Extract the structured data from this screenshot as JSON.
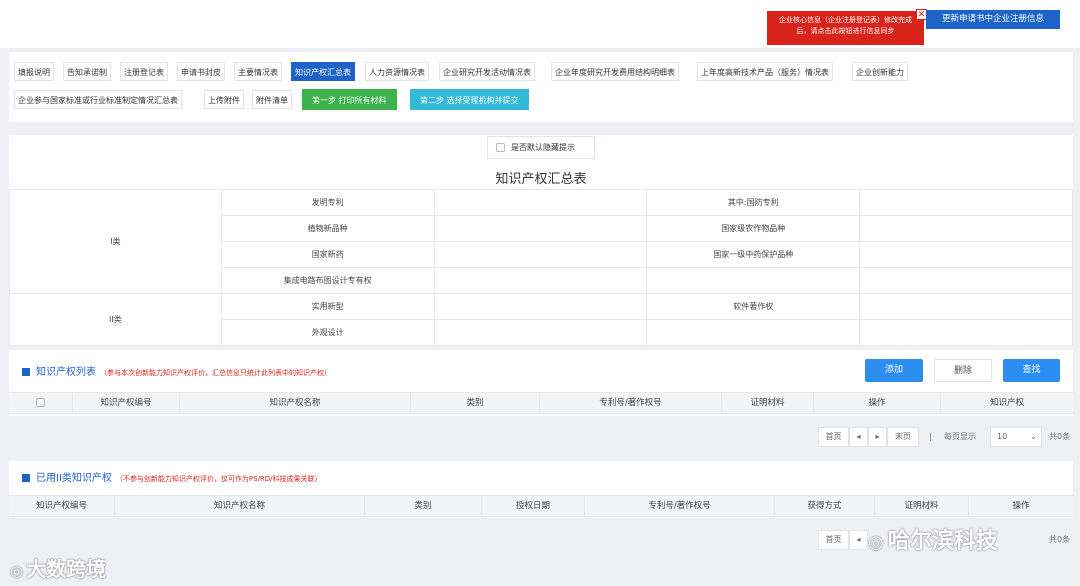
{
  "alert": {
    "text": "企业核心信息（企业注册登记表）修改完成后，请点击此按钮进行信息同步",
    "close_glyph": "✕"
  },
  "update_button": "更新申请书中企业注册信息",
  "tabs": [
    "填报说明",
    "告知承诺制",
    "注册登记表",
    "申请书封皮",
    "主要情况表",
    "知识产权汇总表",
    "人力资源情况表",
    "企业研究开发活动情况表",
    "企业年度研究开发费用结构明细表",
    "上年度高新技术产品（服务）情况表",
    "企业创新能力",
    "企业参与国家标准或行业标准制定情况汇总表",
    "上传附件",
    "附件清单"
  ],
  "step_buttons": {
    "step1": "第一步 打印所有材料",
    "step2": "第二步 选择受理机构并提交"
  },
  "hide_tip_label": "是否默认隐藏提示",
  "summary": {
    "title": "知识产权汇总表",
    "class1": "I类",
    "class2": "II类",
    "rows": [
      [
        "发明专利",
        "其中:国防专利"
      ],
      [
        "植物新品种",
        "国家级农作物品种"
      ],
      [
        "国家新药",
        "国家一级中药保护品种"
      ],
      [
        "集成电路布图设计专有权",
        ""
      ],
      [
        "实用新型",
        "软件著作权"
      ],
      [
        "外观设计",
        ""
      ]
    ]
  },
  "ip_list": {
    "title": "知识产权列表",
    "note": "（参与本次创新能力知识产权评价，汇总信息只统计此列表中的知识产权）",
    "add": "添加",
    "delete": "删除",
    "search": "查找",
    "columns": [
      "知识产权编号",
      "知识产权名称",
      "类别",
      "专利号/著作权号",
      "证明材料",
      "操作",
      "知识产权"
    ]
  },
  "pager": {
    "first": "首页",
    "prev": "◂",
    "next": "▸",
    "last": "末页",
    "sep": "|",
    "per_page_label": "每页显示",
    "per_page": "10",
    "total": "共0条",
    "dropdown": "⌄"
  },
  "class2_list": {
    "title": "已用II类知识产权",
    "note": "（不参与创新能力知识产权评价，仅可作为PS/RD/科技成果关联）",
    "columns": [
      "知识产权编号",
      "知识产权名称",
      "类别",
      "授权日期",
      "专利号/著作权号",
      "获得方式",
      "证明材料",
      "操作"
    ]
  },
  "watermarks": {
    "left": "大数跨境",
    "right": "哈尔滨科技"
  }
}
